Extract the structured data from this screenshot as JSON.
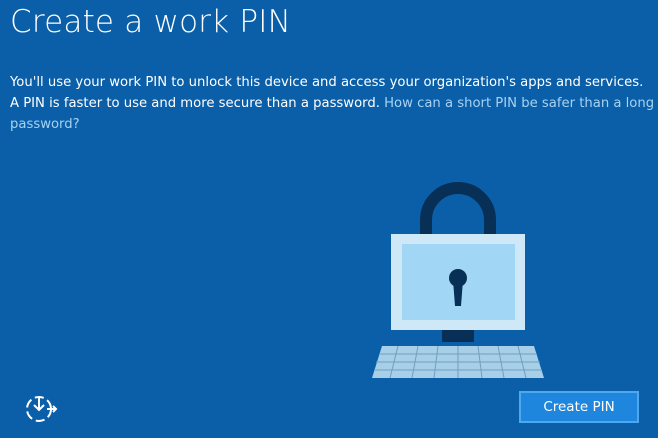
{
  "page": {
    "title": "Create a work PIN",
    "description_line1": "You'll use your work PIN to unlock this device and access your organization's apps and services.",
    "description_line2_text": "A PIN is faster to use and more secure than a password. ",
    "description_link_part1": "How can a short PIN be safer than a long",
    "description_link_part2": "password?"
  },
  "buttons": {
    "create_pin_label": "Create PIN"
  },
  "icons": {
    "accessibility": "ease-of-access-icon",
    "illustration": "padlock-computer-illustration"
  },
  "colors": {
    "background": "#0a5fa8",
    "link": "#a7d2f2",
    "button": "#1e86dc",
    "button_border": "#4ea8ef"
  }
}
